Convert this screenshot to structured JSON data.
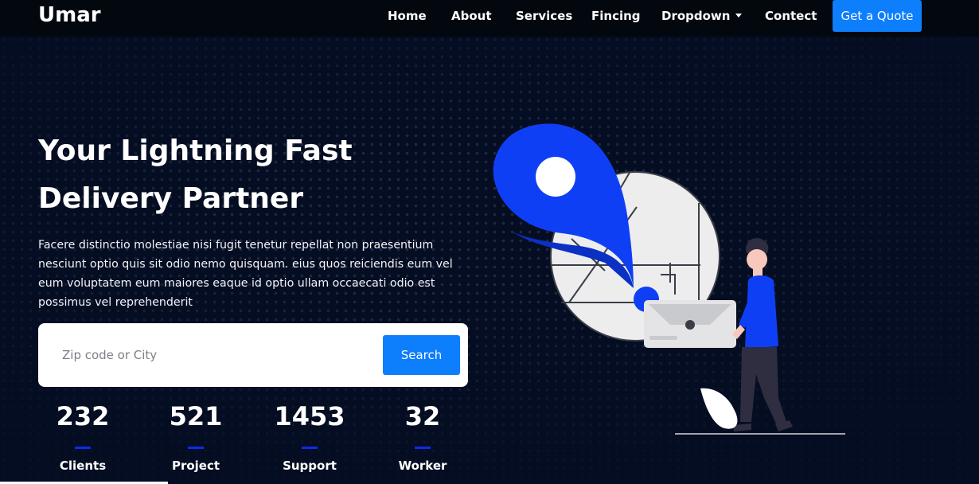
{
  "brand": "Umar",
  "nav": {
    "items": [
      {
        "label": "Home"
      },
      {
        "label": "About"
      },
      {
        "label": "Services"
      },
      {
        "label": "Fincing"
      },
      {
        "label": "Dropdown"
      },
      {
        "label": "Contect"
      }
    ],
    "cta_label": "Get a Quote"
  },
  "hero": {
    "title": "Your Lightning Fast Delivery Partner",
    "description": "Facere distinctio molestiae nisi fugit tenetur repellat non praesentium nesciunt optio quis sit odio nemo quisquam. eius quos reiciendis eum vel eum voluptatem eum maiores eaque id optio ullam occaecati odio est possimus vel reprehenderit"
  },
  "search": {
    "placeholder": "Zip code or City",
    "button_label": "Search"
  },
  "stats": [
    {
      "value": "232",
      "label": "Clients"
    },
    {
      "value": "521",
      "label": "Project"
    },
    {
      "value": "1453",
      "label": "Support"
    },
    {
      "value": "32",
      "label": "Worker"
    }
  ],
  "colors": {
    "background": "#050d22",
    "accent": "#0d7efc",
    "pin": "#0f3ff5"
  },
  "icons": {
    "dropdown": "chevron-down-icon",
    "illustration": "delivery-person-location-pin"
  }
}
